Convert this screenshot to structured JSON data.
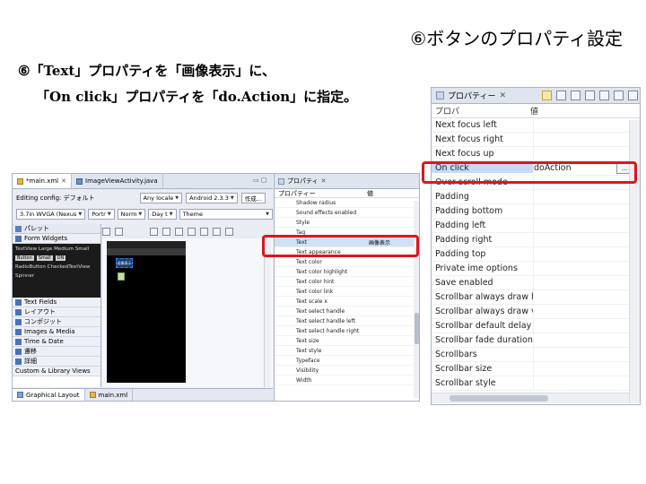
{
  "slide": {
    "title": "⑥ボタンのプロパティ設定",
    "step_line1": "⑥「Text」プロパティを「画像表示」に、",
    "step_line2": "「On click」プロパティを「do.Action」に指定。"
  },
  "editor": {
    "tabs": [
      {
        "label": "*main.xml",
        "icon": "xml-file-icon",
        "active": true
      },
      {
        "label": "ImageViewActivity.java",
        "icon": "java-file-icon",
        "active": false
      }
    ],
    "config_label": "Editing config: デフォルト",
    "toolbar1": {
      "locale": "Any locale",
      "target": "Android 2.3.3",
      "create": "作成..."
    },
    "toolbar2": {
      "device": "3.7in WVGA (Nexus",
      "orientation": "Portr",
      "night": "Norm",
      "dock": "Day t",
      "theme": "Theme"
    },
    "palette": {
      "title": "パレット",
      "groups": [
        "Form Widgets",
        "Text Fields",
        "レイアウト",
        "コンポジット",
        "Images & Media",
        "Time & Date",
        "遷移",
        "詳細",
        "Custom & Library Views"
      ],
      "widget_sample_text": "TextView Large Medium Small",
      "widget_sample_buttons": [
        "Button",
        "Small",
        "ON"
      ],
      "widget_sample_row2": "RadioButton CheckedTextView",
      "widget_sample_row3": "Spinner"
    },
    "canvas_button_label": "画像表示",
    "bottom_tabs": [
      "Graphical Layout",
      "main.xml"
    ]
  },
  "properties_small": {
    "title": "プロパティ",
    "col_key": "プロパティー",
    "col_value": "値",
    "rows": [
      {
        "k": "Shadow radius",
        "v": ""
      },
      {
        "k": "Sound effects enabled",
        "v": ""
      },
      {
        "k": "Style",
        "v": ""
      },
      {
        "k": "Tag",
        "v": ""
      },
      {
        "k": "Text",
        "v": "画像表示",
        "selected": true
      },
      {
        "k": "Text appearance",
        "v": ""
      },
      {
        "k": "Text color",
        "v": ""
      },
      {
        "k": "Text color highlight",
        "v": ""
      },
      {
        "k": "Text color hint",
        "v": ""
      },
      {
        "k": "Text color link",
        "v": ""
      },
      {
        "k": "Text scale x",
        "v": ""
      },
      {
        "k": "Text select handle",
        "v": ""
      },
      {
        "k": "Text select handle left",
        "v": ""
      },
      {
        "k": "Text select handle right",
        "v": ""
      },
      {
        "k": "Text size",
        "v": ""
      },
      {
        "k": "Text style",
        "v": ""
      },
      {
        "k": "Typeface",
        "v": ""
      },
      {
        "k": "Visibility",
        "v": ""
      },
      {
        "k": "Width",
        "v": ""
      }
    ]
  },
  "properties_large": {
    "title": "プロパティー",
    "col_key": "プロパ",
    "col_value": "値",
    "rows": [
      {
        "k": "Next focus left",
        "v": ""
      },
      {
        "k": "Next focus right",
        "v": ""
      },
      {
        "k": "Next focus up",
        "v": ""
      },
      {
        "k": "On click",
        "v": "doAction",
        "selected": true,
        "button": "..."
      },
      {
        "k": "Over scroll mode",
        "v": ""
      },
      {
        "k": "Padding",
        "v": ""
      },
      {
        "k": "Padding bottom",
        "v": ""
      },
      {
        "k": "Padding left",
        "v": ""
      },
      {
        "k": "Padding right",
        "v": ""
      },
      {
        "k": "Padding top",
        "v": ""
      },
      {
        "k": "Private ime options",
        "v": ""
      },
      {
        "k": "Save enabled",
        "v": ""
      },
      {
        "k": "Scrollbar always draw ho",
        "v": ""
      },
      {
        "k": "Scrollbar always draw ve",
        "v": ""
      },
      {
        "k": "Scrollbar default delay be",
        "v": ""
      },
      {
        "k": "Scrollbar fade duration",
        "v": ""
      },
      {
        "k": "Scrollbars",
        "v": ""
      },
      {
        "k": "Scrollbar size",
        "v": ""
      },
      {
        "k": "Scrollbar style",
        "v": ""
      }
    ]
  },
  "colors": {
    "highlight_box": "#e0151c",
    "selection": "#c5daf6"
  }
}
